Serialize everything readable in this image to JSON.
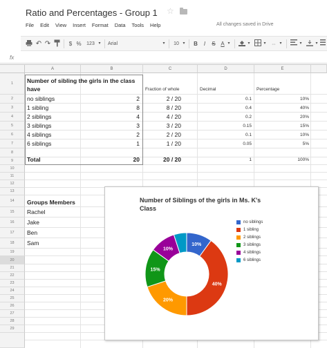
{
  "document": {
    "title": "Ratio and Percentages - Group 1",
    "save_status": "All changes saved in Drive"
  },
  "menu": [
    "File",
    "Edit",
    "View",
    "Insert",
    "Format",
    "Data",
    "Tools",
    "Help"
  ],
  "toolbar": {
    "currency": "$",
    "percent": "%",
    "number_format": "123",
    "font": "Arial",
    "font_size": "10",
    "bold": "B",
    "italic": "I",
    "strikethrough": "S",
    "text_color": "A"
  },
  "formula_bar": {
    "fx": "fx"
  },
  "columns": [
    "A",
    "B",
    "C",
    "D",
    "E"
  ],
  "rows": [
    "1",
    "2",
    "3",
    "4",
    "5",
    "6",
    "7",
    "8",
    "9",
    "10",
    "11",
    "12",
    "13",
    "14",
    "15",
    "16",
    "17",
    "18",
    "19",
    "20",
    "21",
    "22",
    "23",
    "24",
    "25",
    "26",
    "27",
    "28",
    "29"
  ],
  "selected_row": "20",
  "table": {
    "header": {
      "a": "Number of sibling the girls in the class have",
      "c": "Fraction of whole",
      "d": "Decimal",
      "e": "Percentage"
    },
    "rows": [
      {
        "a": "no siblings",
        "b": "2",
        "c": "2 / 20",
        "d": "0.1",
        "e": "10%"
      },
      {
        "a": "1 sibling",
        "b": "8",
        "c": "8 / 20",
        "d": "0.4",
        "e": "40%"
      },
      {
        "a": "2 siblings",
        "b": "4",
        "c": "4 / 20",
        "d": "0.2",
        "e": "20%"
      },
      {
        "a": "3 siblings",
        "b": "3",
        "c": "3 / 20",
        "d": "0.15",
        "e": "15%"
      },
      {
        "a": "4 siblings",
        "b": "2",
        "c": "2 / 20",
        "d": "0.1",
        "e": "10%"
      },
      {
        "a": "6 siblings",
        "b": "1",
        "c": "1 / 20",
        "d": "0.05",
        "e": "5%"
      }
    ],
    "total": {
      "a": "Total",
      "b": "20",
      "c": "20 / 20",
      "d": "1",
      "e": "100%"
    }
  },
  "group": {
    "title": "Groups Members",
    "members": [
      "Rachel",
      "Jake",
      "Ben",
      "Sam"
    ]
  },
  "chart_data": {
    "type": "pie",
    "donut": true,
    "title": "Number of Siblings of the girls in Ms. K's Class",
    "categories": [
      "no siblings",
      "1 sibling",
      "2 siblings",
      "3 siblings",
      "4 siblings",
      "6 siblings"
    ],
    "values": [
      2,
      8,
      4,
      3,
      2,
      1
    ],
    "slice_labels": [
      "10%",
      "40%",
      "20%",
      "15%",
      "10%",
      ""
    ],
    "colors": [
      "#3366cc",
      "#dc3912",
      "#ff9900",
      "#109618",
      "#990099",
      "#0099c6"
    ],
    "legend_position": "right"
  }
}
